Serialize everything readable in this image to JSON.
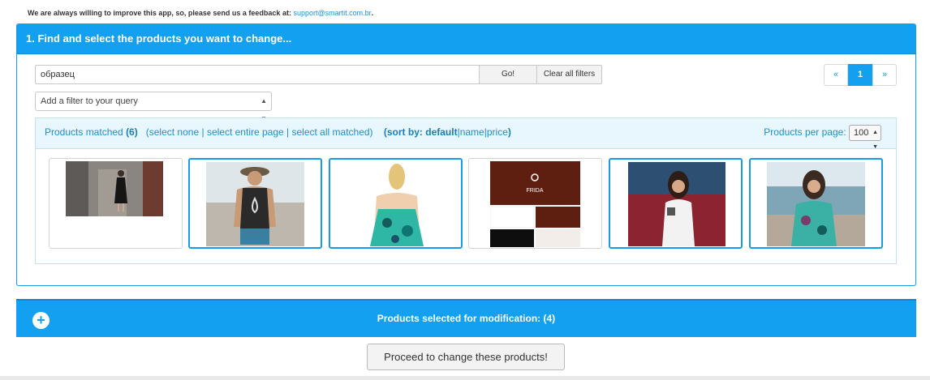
{
  "feedback": {
    "text": "We are always willing to improve this app, so, please send us a feedback at:",
    "email": "support@smartit.com.br",
    "period": "."
  },
  "panel1": {
    "title": "1. Find and select the products you want to change..."
  },
  "search": {
    "value": "образец",
    "go_label": "Go!",
    "clear_label": "Clear all filters"
  },
  "pagination": {
    "prev": "«",
    "current": "1",
    "next": "»"
  },
  "filter": {
    "label": "Add a filter to your query"
  },
  "matched": {
    "label": "Products matched",
    "count": "(6)",
    "open_paren": "(",
    "select_none": "select none",
    "select_page": "select entire page",
    "select_all": "select all matched",
    "close_paren": ")",
    "sort_label": "(sort by:",
    "sort_default": "default",
    "sort_name": "name",
    "sort_price": "price",
    "sort_close": ")",
    "per_page_label": "Products per page:",
    "per_page_value": "100"
  },
  "products": [
    {
      "selected": false
    },
    {
      "selected": true
    },
    {
      "selected": true
    },
    {
      "selected": false
    },
    {
      "selected": true
    },
    {
      "selected": true
    }
  ],
  "logo_text": "FRIDA",
  "panel2": {
    "label": "Products selected for modification:",
    "count": "(4)"
  },
  "proceed_label": "Proceed to change these products!",
  "colors": {
    "primary": "#14a0f0",
    "light": "#e8f6fd"
  }
}
